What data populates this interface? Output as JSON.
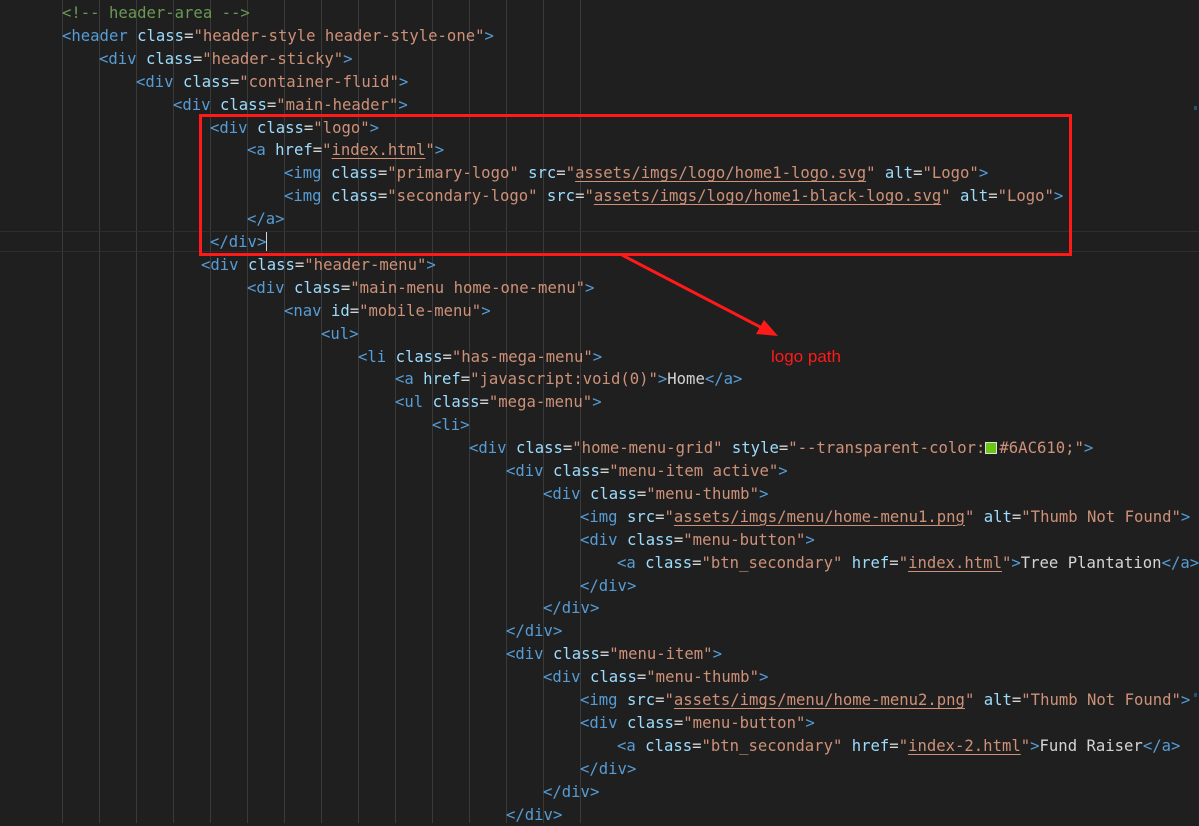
{
  "theme": {
    "background": "#1f1f1f",
    "tag": "#569cd6",
    "attribute": "#9cdcfe",
    "string": "#ce9178",
    "comment": "#6a9955",
    "text": "#d4d4d4",
    "annotation": "#ff1a1a"
  },
  "annotation": {
    "label": "logo path",
    "box_color": "#ff1a1a"
  },
  "lines": [
    [
      [
        "cmt",
        "<!-- header-area -->"
      ]
    ],
    [
      [
        "tag",
        "<header"
      ],
      [
        "txt",
        " "
      ],
      [
        "attr",
        "class"
      ],
      [
        "txt",
        "="
      ],
      [
        "str",
        "\"header-style header-style-one\""
      ],
      [
        "tag",
        ">"
      ]
    ],
    [
      [
        "tag",
        "<div"
      ],
      [
        "txt",
        " "
      ],
      [
        "attr",
        "class"
      ],
      [
        "txt",
        "="
      ],
      [
        "str",
        "\"header-sticky\""
      ],
      [
        "tag",
        ">"
      ]
    ],
    [
      [
        "tag",
        "<div"
      ],
      [
        "txt",
        " "
      ],
      [
        "attr",
        "class"
      ],
      [
        "txt",
        "="
      ],
      [
        "str",
        "\"container-fluid\""
      ],
      [
        "tag",
        ">"
      ]
    ],
    [
      [
        "tag",
        "<div"
      ],
      [
        "txt",
        " "
      ],
      [
        "attr",
        "class"
      ],
      [
        "txt",
        "="
      ],
      [
        "str",
        "\"main-header\""
      ],
      [
        "tag",
        ">"
      ]
    ],
    [
      [
        "tag",
        "<div"
      ],
      [
        "txt",
        " "
      ],
      [
        "attr",
        "class"
      ],
      [
        "txt",
        "="
      ],
      [
        "str",
        "\"logo\""
      ],
      [
        "tag",
        ">"
      ]
    ],
    [
      [
        "tag",
        "<a"
      ],
      [
        "txt",
        " "
      ],
      [
        "attr",
        "href"
      ],
      [
        "txt",
        "="
      ],
      [
        "str",
        "\""
      ],
      [
        "link",
        "index.html"
      ],
      [
        "str",
        "\""
      ],
      [
        "tag",
        ">"
      ]
    ],
    [
      [
        "tag",
        "<img"
      ],
      [
        "txt",
        " "
      ],
      [
        "attr",
        "class"
      ],
      [
        "txt",
        "="
      ],
      [
        "str",
        "\"primary-logo\""
      ],
      [
        "txt",
        " "
      ],
      [
        "attr",
        "src"
      ],
      [
        "txt",
        "="
      ],
      [
        "str",
        "\""
      ],
      [
        "link",
        "assets/imgs/logo/home1-logo.svg"
      ],
      [
        "str",
        "\""
      ],
      [
        "txt",
        " "
      ],
      [
        "attr",
        "alt"
      ],
      [
        "txt",
        "="
      ],
      [
        "str",
        "\"Logo\""
      ],
      [
        "tag",
        ">"
      ]
    ],
    [
      [
        "tag",
        "<img"
      ],
      [
        "txt",
        " "
      ],
      [
        "attr",
        "class"
      ],
      [
        "txt",
        "="
      ],
      [
        "str",
        "\"secondary-logo\""
      ],
      [
        "txt",
        " "
      ],
      [
        "attr",
        "src"
      ],
      [
        "txt",
        "="
      ],
      [
        "str",
        "\""
      ],
      [
        "link",
        "assets/imgs/logo/home1-black-logo.svg"
      ],
      [
        "str",
        "\""
      ],
      [
        "txt",
        " "
      ],
      [
        "attr",
        "alt"
      ],
      [
        "txt",
        "="
      ],
      [
        "str",
        "\"Logo\""
      ],
      [
        "tag",
        ">"
      ]
    ],
    [
      [
        "tag",
        "</a>"
      ]
    ],
    [
      [
        "tag",
        "</div>"
      ],
      [
        "caret",
        ""
      ]
    ],
    [
      [
        "tag",
        "<div"
      ],
      [
        "txt",
        " "
      ],
      [
        "attr",
        "class"
      ],
      [
        "txt",
        "="
      ],
      [
        "str",
        "\"header-menu\""
      ],
      [
        "tag",
        ">"
      ]
    ],
    [
      [
        "tag",
        "<div"
      ],
      [
        "txt",
        " "
      ],
      [
        "attr",
        "class"
      ],
      [
        "txt",
        "="
      ],
      [
        "str",
        "\"main-menu home-one-menu\""
      ],
      [
        "tag",
        ">"
      ]
    ],
    [
      [
        "tag",
        "<nav"
      ],
      [
        "txt",
        " "
      ],
      [
        "attr",
        "id"
      ],
      [
        "txt",
        "="
      ],
      [
        "str",
        "\"mobile-menu\""
      ],
      [
        "tag",
        ">"
      ]
    ],
    [
      [
        "tag",
        "<ul>"
      ]
    ],
    [
      [
        "tag",
        "<li"
      ],
      [
        "txt",
        " "
      ],
      [
        "attr",
        "class"
      ],
      [
        "txt",
        "="
      ],
      [
        "str",
        "\"has-mega-menu\""
      ],
      [
        "tag",
        ">"
      ]
    ],
    [
      [
        "tag",
        "<a"
      ],
      [
        "txt",
        " "
      ],
      [
        "attr",
        "href"
      ],
      [
        "txt",
        "="
      ],
      [
        "str",
        "\"javascript:void(0)\""
      ],
      [
        "tag",
        ">"
      ],
      [
        "txt",
        "Home"
      ],
      [
        "tag",
        "</a>"
      ]
    ],
    [
      [
        "tag",
        "<ul"
      ],
      [
        "txt",
        " "
      ],
      [
        "attr",
        "class"
      ],
      [
        "txt",
        "="
      ],
      [
        "str",
        "\"mega-menu\""
      ],
      [
        "tag",
        ">"
      ]
    ],
    [
      [
        "tag",
        "<li>"
      ]
    ],
    [
      [
        "tag",
        "<div"
      ],
      [
        "txt",
        " "
      ],
      [
        "attr",
        "class"
      ],
      [
        "txt",
        "="
      ],
      [
        "str",
        "\"home-menu-grid\""
      ],
      [
        "txt",
        " "
      ],
      [
        "attr",
        "style"
      ],
      [
        "txt",
        "="
      ],
      [
        "str",
        "\"--transparent-color:"
      ],
      [
        "swatch",
        "#6AC610"
      ],
      [
        "str",
        "#6AC610;\""
      ],
      [
        "tag",
        ">"
      ]
    ],
    [
      [
        "tag",
        "<div"
      ],
      [
        "txt",
        " "
      ],
      [
        "attr",
        "class"
      ],
      [
        "txt",
        "="
      ],
      [
        "str",
        "\"menu-item active\""
      ],
      [
        "tag",
        ">"
      ]
    ],
    [
      [
        "tag",
        "<div"
      ],
      [
        "txt",
        " "
      ],
      [
        "attr",
        "class"
      ],
      [
        "txt",
        "="
      ],
      [
        "str",
        "\"menu-thumb\""
      ],
      [
        "tag",
        ">"
      ]
    ],
    [
      [
        "tag",
        "<img"
      ],
      [
        "txt",
        " "
      ],
      [
        "attr",
        "src"
      ],
      [
        "txt",
        "="
      ],
      [
        "str",
        "\""
      ],
      [
        "link",
        "assets/imgs/menu/home-menu1.png"
      ],
      [
        "str",
        "\""
      ],
      [
        "txt",
        " "
      ],
      [
        "attr",
        "alt"
      ],
      [
        "txt",
        "="
      ],
      [
        "str",
        "\"Thumb Not Found\""
      ],
      [
        "tag",
        ">"
      ]
    ],
    [
      [
        "tag",
        "<div"
      ],
      [
        "txt",
        " "
      ],
      [
        "attr",
        "class"
      ],
      [
        "txt",
        "="
      ],
      [
        "str",
        "\"menu-button\""
      ],
      [
        "tag",
        ">"
      ]
    ],
    [
      [
        "tag",
        "<a"
      ],
      [
        "txt",
        " "
      ],
      [
        "attr",
        "class"
      ],
      [
        "txt",
        "="
      ],
      [
        "str",
        "\"btn_secondary\""
      ],
      [
        "txt",
        " "
      ],
      [
        "attr",
        "href"
      ],
      [
        "txt",
        "="
      ],
      [
        "str",
        "\""
      ],
      [
        "link",
        "index.html"
      ],
      [
        "str",
        "\""
      ],
      [
        "tag",
        ">"
      ],
      [
        "txt",
        "Tree Plantation"
      ],
      [
        "tag",
        "</a>"
      ]
    ],
    [
      [
        "tag",
        "</div>"
      ]
    ],
    [
      [
        "tag",
        "</div>"
      ]
    ],
    [
      [
        "tag",
        "</div>"
      ]
    ],
    [
      [
        "tag",
        "<div"
      ],
      [
        "txt",
        " "
      ],
      [
        "attr",
        "class"
      ],
      [
        "txt",
        "="
      ],
      [
        "str",
        "\"menu-item\""
      ],
      [
        "tag",
        ">"
      ]
    ],
    [
      [
        "tag",
        "<div"
      ],
      [
        "txt",
        " "
      ],
      [
        "attr",
        "class"
      ],
      [
        "txt",
        "="
      ],
      [
        "str",
        "\"menu-thumb\""
      ],
      [
        "tag",
        ">"
      ]
    ],
    [
      [
        "tag",
        "<img"
      ],
      [
        "txt",
        " "
      ],
      [
        "attr",
        "src"
      ],
      [
        "txt",
        "="
      ],
      [
        "str",
        "\""
      ],
      [
        "link",
        "assets/imgs/menu/home-menu2.png"
      ],
      [
        "str",
        "\""
      ],
      [
        "txt",
        " "
      ],
      [
        "attr",
        "alt"
      ],
      [
        "txt",
        "="
      ],
      [
        "str",
        "\"Thumb Not Found\""
      ],
      [
        "tag",
        ">"
      ]
    ],
    [
      [
        "tag",
        "<div"
      ],
      [
        "txt",
        " "
      ],
      [
        "attr",
        "class"
      ],
      [
        "txt",
        "="
      ],
      [
        "str",
        "\"menu-button\""
      ],
      [
        "tag",
        ">"
      ]
    ],
    [
      [
        "tag",
        "<a"
      ],
      [
        "txt",
        " "
      ],
      [
        "attr",
        "class"
      ],
      [
        "txt",
        "="
      ],
      [
        "str",
        "\"btn_secondary\""
      ],
      [
        "txt",
        " "
      ],
      [
        "attr",
        "href"
      ],
      [
        "txt",
        "="
      ],
      [
        "str",
        "\""
      ],
      [
        "link",
        "index-2.html"
      ],
      [
        "str",
        "\""
      ],
      [
        "tag",
        ">"
      ],
      [
        "txt",
        "Fund Raiser"
      ],
      [
        "tag",
        "</a>"
      ]
    ],
    [
      [
        "tag",
        "</div>"
      ]
    ],
    [
      [
        "tag",
        "</div>"
      ]
    ],
    [
      [
        "tag",
        "</div>"
      ]
    ]
  ]
}
